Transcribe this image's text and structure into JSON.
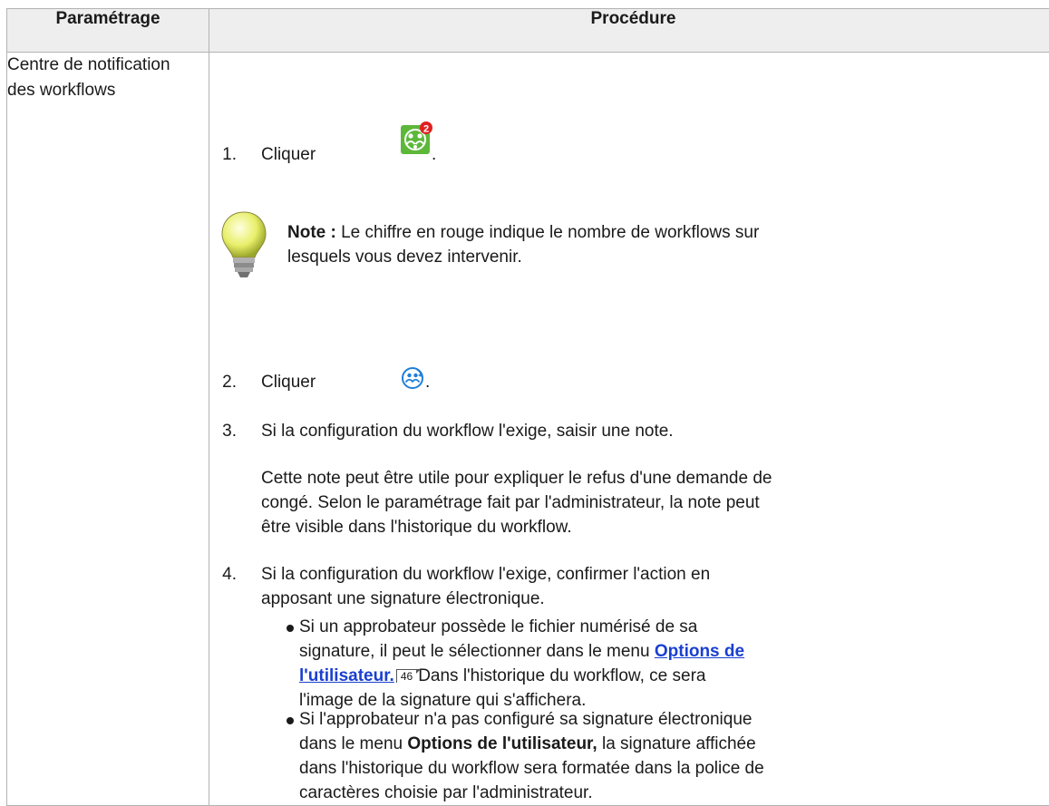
{
  "table": {
    "header_setting": "Paramétrage",
    "header_procedure": "Procédure",
    "setting_line1": "Centre de notification",
    "setting_line2": "des workflows"
  },
  "steps": {
    "s1_num": "1.",
    "s1_text": "Cliquer",
    "s1_after": ".",
    "badge_count": "2",
    "note_label": "Note :",
    "note_line1": "Le chiffre en rouge indique le nombre de workflows sur",
    "note_line2": "lesquels vous devez intervenir.",
    "s2_num": "2.",
    "s2_text": "Cliquer",
    "s2_after": ".",
    "s3_num": "3.",
    "s3_text": "Si la configuration du workflow l'exige, saisir une note.",
    "p3_line1": "Cette note peut être utile pour expliquer le refus d'une demande de",
    "p3_line2": "congé. Selon le paramétrage fait par l'administrateur, la note peut",
    "p3_line3": "être visible dans l'historique du workflow.",
    "s4_num": "4.",
    "s4_line1": "Si la configuration du workflow l'exige, confirmer l'action en",
    "s4_line2": "apposant une signature électronique.",
    "b1_line1": "Si un approbateur possède le fichier numérisé de sa",
    "b1_line2_pre": "signature, il peut le sélectionner dans le menu",
    "b1_link_part1": "Options de",
    "b1_link_part2": "l'utilisateur.",
    "b1_ref": "46",
    "b1_line3_post": "Dans l'historique du workflow, ce sera",
    "b1_line4": "l'image de la signature qui s'affichera.",
    "b2_line1": "Si l'approbateur n'a pas configuré sa signature électronique",
    "b2_line2_pre": "dans le menu",
    "b2_bold": "Options de l'utilisateur,",
    "b2_line2_post": "la signature affichée",
    "b2_line3": "dans l'historique du workflow sera formatée dans la police de",
    "b2_line4": "caractères choisie par l'administrateur."
  },
  "icons": {
    "notif": "workflow-notification-icon",
    "bulb": "lightbulb-icon",
    "reject": "workflow-reject-icon"
  },
  "colors": {
    "link": "#1a3fd0",
    "badge": "#e02020",
    "icon_green": "#5db83a",
    "icon_blue": "#1e7fd8"
  }
}
